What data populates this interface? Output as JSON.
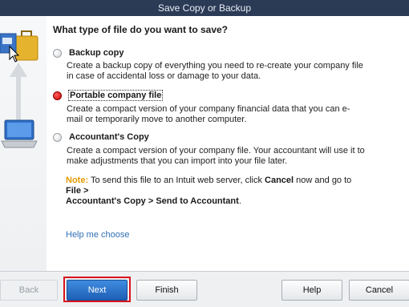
{
  "window": {
    "title": "Save Copy or Backup"
  },
  "question": "What type of file do you want to save?",
  "options": [
    {
      "label": "Backup copy",
      "description": "Create a backup copy of everything you need to re-create your company file in case of accidental loss or damage to your data.",
      "selected": false
    },
    {
      "label": "Portable company file",
      "description": "Create a compact version of your company financial data that you can e-mail or temporarily move to another computer.",
      "selected": true
    },
    {
      "label": "Accountant's Copy",
      "description": "Create a compact version of your company file. Your accountant will use it to make adjustments that you can import into your file later.",
      "selected": false
    }
  ],
  "note": {
    "label": "Note:",
    "text_1": "To send this file to an Intuit web server, click",
    "cancel": "Cancel",
    "text_2": "now and go to",
    "file": "File >",
    "path": "Accountant's Copy > Send to Accountant",
    "end": "."
  },
  "help_link": "Help me choose",
  "buttons": {
    "back": "Back",
    "next": "Next",
    "finish": "Finish",
    "help": "Help",
    "cancel": "Cancel"
  },
  "colors": {
    "title_bar": "#2b3a55",
    "selected_radio": "#d00000",
    "note_label": "#e39a00",
    "link": "#2f6fb5",
    "highlight": "#d9141e",
    "primary_button": "#1e5fb5"
  }
}
